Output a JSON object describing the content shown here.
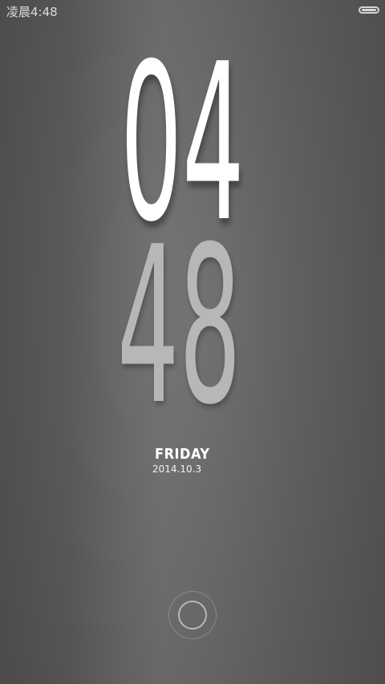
{
  "status_bar": {
    "time": "凌晨4:48",
    "battery_icon": "battery-full-icon"
  },
  "clock": {
    "hours": "04",
    "minutes": "48",
    "colors": {
      "hours": "#ffffff",
      "minutes": "#b7b7b7"
    }
  },
  "date": {
    "weekday": "FRIDAY",
    "date_text": "2014.10.3"
  },
  "unlock": {
    "icon": "unlock-ring-icon"
  },
  "colors": {
    "background": "#666666",
    "text_primary": "#ffffff"
  }
}
